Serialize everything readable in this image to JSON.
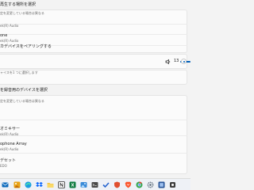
{
  "output": {
    "choose_label": "再生する場所を選択",
    "devices": [
      {
        "name": "",
        "sub": "定を変更している場合は異なる"
      },
      {
        "name": "",
        "sub": "ek(R) Audio"
      },
      {
        "name": "one",
        "sub": "ek(R) Audio"
      }
    ],
    "pair_label": "カデバイスをペアリングする",
    "volume_value": "13"
  },
  "input": {
    "info_text": "ャイスを1 つに選択します",
    "choose_label": "を録音用のデバイスを選択",
    "devices": [
      {
        "name": "",
        "sub": "定を変更している場合は異なる"
      },
      {
        "name": "オミキサー",
        "sub": "ek(R) Audio"
      },
      {
        "name": "ophone Array",
        "sub": "ek(R) Audio"
      },
      {
        "name": "デセット",
        "sub": "EDO"
      }
    ]
  },
  "taskbar": {
    "icons": [
      {
        "name": "mail-icon",
        "color": "#0f6cbd"
      },
      {
        "name": "gallery-icon",
        "color": "#e8a317"
      },
      {
        "name": "edge-icon",
        "color": "#1b9de2"
      },
      {
        "name": "dropbox-icon",
        "color": "#0061fe"
      },
      {
        "name": "explorer-icon",
        "color": "#f4c542"
      },
      {
        "name": "notion-icon",
        "color": "#2e2e2e"
      },
      {
        "name": "excel-icon",
        "color": "#107c41"
      },
      {
        "name": "photos-icon",
        "color": "#3a8bd8"
      },
      {
        "name": "terminal-icon",
        "color": "#4a4a4a"
      },
      {
        "name": "todo-icon",
        "color": "#2564cf"
      },
      {
        "name": "shield-icon",
        "color": "#e04f2f"
      },
      {
        "name": "brave-icon",
        "color": "#fb542b"
      },
      {
        "name": "chrome-icon",
        "color": "#34a853"
      },
      {
        "name": "settings-icon",
        "color": "#5b6b7a"
      },
      {
        "name": "app-icon",
        "color": "#2b579a"
      },
      {
        "name": "misc-icon",
        "color": "#3c3c3c"
      }
    ]
  }
}
